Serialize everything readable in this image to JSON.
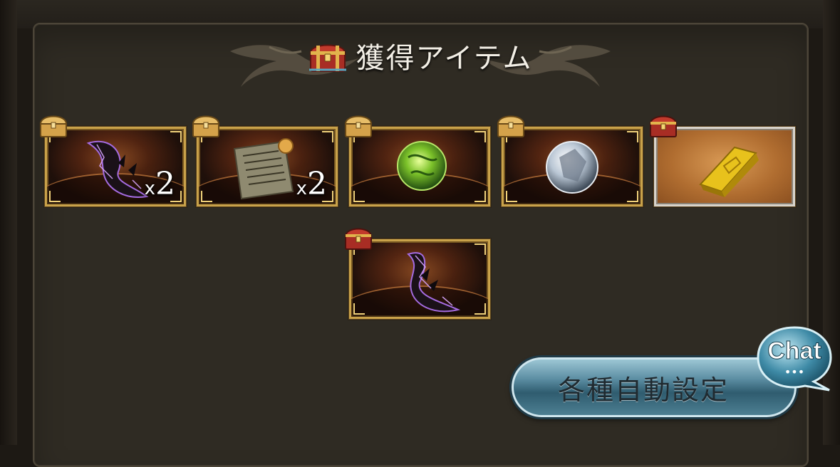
{
  "title": "獲得アイテム",
  "items_row1": [
    {
      "icon": "dark-horn-icon",
      "qty_prefix": "x",
      "qty_value": "2",
      "chest": "gold-chest-icon"
    },
    {
      "icon": "scroll-icon",
      "qty_prefix": "x",
      "qty_value": "2",
      "chest": "gold-chest-icon"
    },
    {
      "icon": "green-orb-icon",
      "qty_prefix": "",
      "qty_value": "",
      "chest": "gold-chest-icon"
    },
    {
      "icon": "silver-orb-icon",
      "qty_prefix": "",
      "qty_value": "",
      "chest": "gold-chest-icon"
    },
    {
      "icon": "gold-bar-icon",
      "qty_prefix": "",
      "qty_value": "",
      "chest": "red-chest-icon"
    }
  ],
  "items_row2": [
    {
      "icon": "dark-horn-icon",
      "qty_prefix": "",
      "qty_value": "",
      "chest": "red-chest-icon"
    }
  ],
  "buttons": {
    "settings_label": "各種自動設定",
    "chat_label": "Chat",
    "chat_dots": "•••"
  },
  "colors": {
    "panel_bg": "#2f2b23",
    "frame_gold": "#c9a24a",
    "button_blue": "#5c8ea3",
    "title_text": "#f3efe6"
  }
}
